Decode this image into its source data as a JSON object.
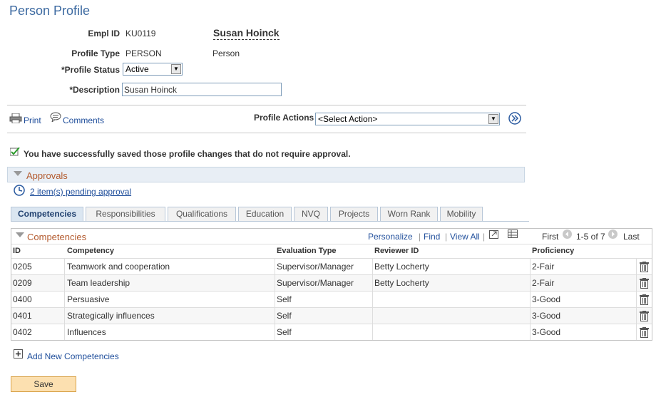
{
  "page": {
    "title": "Person Profile"
  },
  "profile": {
    "empl_id_label": "Empl ID",
    "empl_id": "KU0119",
    "person_name": "Susan Hoinck",
    "profile_type_label": "Profile Type",
    "profile_type": "PERSON",
    "profile_type_desc": "Person",
    "profile_status_label": "*Profile Status",
    "profile_status": "Active",
    "description_label": "*Description",
    "description": "Susan Hoinck"
  },
  "toolbar": {
    "print": "Print",
    "comments": "Comments",
    "profile_actions_label": "Profile Actions",
    "profile_actions_value": "<Select Action>"
  },
  "message": "You have successfully saved those profile changes that do not require approval.",
  "approvals": {
    "title": "Approvals",
    "pending_link": "2 item(s) pending approval"
  },
  "tabs": [
    {
      "label": "Competencies",
      "active": true
    },
    {
      "label": "Responsibilities"
    },
    {
      "label": "Qualifications"
    },
    {
      "label": "Education"
    },
    {
      "label": "NVQ"
    },
    {
      "label": "Projects"
    },
    {
      "label": "Worn Rank"
    },
    {
      "label": "Mobility"
    }
  ],
  "grid": {
    "title": "Competencies",
    "personalize": "Personalize",
    "find": "Find",
    "view_all": "View All",
    "first": "First",
    "range": "1-5 of 7",
    "last": "Last",
    "columns": [
      "ID",
      "Competency",
      "Evaluation Type",
      "Reviewer ID",
      "Proficiency"
    ],
    "rows": [
      {
        "id": "0205",
        "competency": "Teamwork and cooperation",
        "evaluation": "Supervisor/Manager",
        "reviewer": "Betty Locherty",
        "proficiency": "2-Fair"
      },
      {
        "id": "0209",
        "competency": "Team leadership",
        "evaluation": "Supervisor/Manager",
        "reviewer": "Betty Locherty",
        "proficiency": "2-Fair"
      },
      {
        "id": "0400",
        "competency": "Persuasive",
        "evaluation": "Self",
        "reviewer": "",
        "proficiency": "3-Good"
      },
      {
        "id": "0401",
        "competency": "Strategically influences",
        "evaluation": "Self",
        "reviewer": "",
        "proficiency": "3-Good"
      },
      {
        "id": "0402",
        "competency": "Influences",
        "evaluation": "Self",
        "reviewer": "",
        "proficiency": "3-Good"
      }
    ],
    "add_new": "Add New Competencies"
  },
  "save_button": "Save"
}
